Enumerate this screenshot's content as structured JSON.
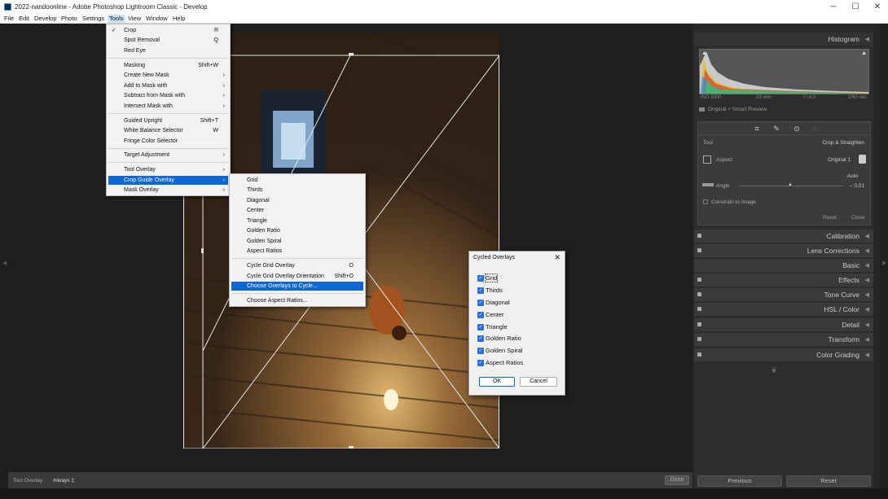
{
  "window": {
    "title": "2022-nandoonline - Adobe Photoshop Lightroom Classic - Develop",
    "minimize": "─",
    "maximize": "☐",
    "close": "✕"
  },
  "menubar": [
    "File",
    "Edit",
    "Develop",
    "Photo",
    "Settings",
    "Tools",
    "View",
    "Window",
    "Help"
  ],
  "tools_menu": [
    {
      "label": "Crop",
      "shortcut": "R",
      "checked": "✓"
    },
    {
      "label": "Spot Removal",
      "shortcut": "Q"
    },
    {
      "label": "Red Eye"
    },
    {
      "label": "Masking",
      "shortcut": "Shift+W"
    },
    {
      "label": "Create New Mask",
      "submenu": "›"
    },
    {
      "label": "Add to Mask with",
      "submenu": "›"
    },
    {
      "label": "Subtract from Mask with",
      "submenu": "›"
    },
    {
      "label": "Intersect Mask with",
      "submenu": "›"
    },
    {
      "label": "Guided Upright",
      "shortcut": "Shift+T"
    },
    {
      "label": "White Balance Selector",
      "shortcut": "W"
    },
    {
      "label": "Fringe Color Selector"
    },
    {
      "label": "Target Adjustment",
      "submenu": "›"
    },
    {
      "label": "Tool Overlay",
      "submenu": "›"
    },
    {
      "label": "Crop Guide Overlay",
      "submenu": "›"
    },
    {
      "label": "Mask Overlay",
      "submenu": "›"
    }
  ],
  "crop_guide_submenu": [
    {
      "label": "Grid"
    },
    {
      "label": "Thirds"
    },
    {
      "label": "Diagonal"
    },
    {
      "label": "Center"
    },
    {
      "label": "Triangle"
    },
    {
      "label": "Golden Ratio"
    },
    {
      "label": "Golden Spiral"
    },
    {
      "label": "Aspect Ratios"
    },
    {
      "label": "Cycle Grid Overlay",
      "shortcut": "O"
    },
    {
      "label": "Cycle Grid Overlay Orientation",
      "shortcut": "Shift+O"
    },
    {
      "label": "Choose Overlays to Cycle..."
    },
    {
      "label": "Choose Aspect Ratios..."
    }
  ],
  "dialog": {
    "title": "Cycled Overlays",
    "close": "✕",
    "options": [
      "Grid",
      "Thirds",
      "Diagonal",
      "Center",
      "Triangle",
      "Golden Ratio",
      "Golden Spiral",
      "Aspect Ratios"
    ],
    "check": "✓",
    "ok": "OK",
    "cancel": "Cancel"
  },
  "right_panel": {
    "histogram_title": "Histogram",
    "iso": "ISO 3200",
    "focal": "23 mm",
    "aperture": "f / 4,0",
    "shutter": "1/60 sec",
    "preview": "Original + Smart Preview",
    "tool_label": "Tool",
    "tool_value": "Crop & Straighten",
    "aspect_label": "Aspect",
    "aspect_value": "Original ‡",
    "auto": "Auto",
    "angle_label": "Angle",
    "angle_value": "– 0,01",
    "constrain": "Constrain to Image",
    "reset": "Reset",
    "close": "Close",
    "panels": [
      "Calibration",
      "Lens Corrections",
      "Basic",
      "Effects",
      "Tone Curve",
      "HSL / Color",
      "Detail",
      "Transform",
      "Color Grading"
    ],
    "previous_btn": "Previous",
    "reset_btn": "Reset"
  },
  "bottom_bar": {
    "label": "Tool Overlay :",
    "value": "Always ‡",
    "done": "Done"
  }
}
